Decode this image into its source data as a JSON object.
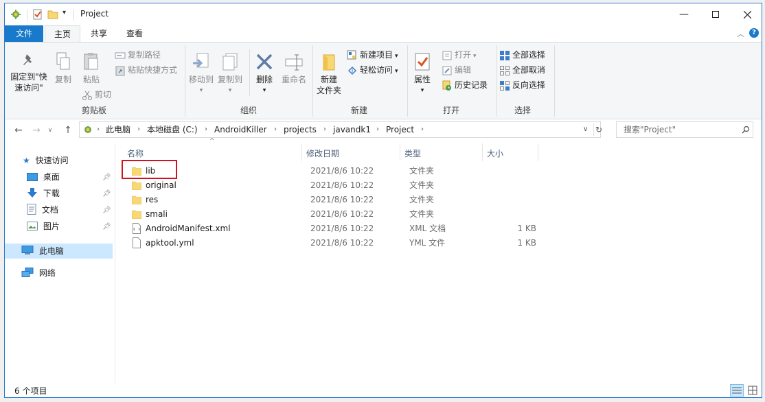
{
  "window": {
    "title": "Project"
  },
  "ribbon_tabs": [
    "文件",
    "主页",
    "共享",
    "查看"
  ],
  "clipboard": {
    "pin_label_1": "固定到\"快",
    "pin_label_2": "速访问\"",
    "copy": "复制",
    "paste": "粘贴",
    "copy_path": "复制路径",
    "paste_shortcut": "粘贴快捷方式",
    "cut": "剪切",
    "group": "剪贴板"
  },
  "organize": {
    "move_to": "移动到",
    "copy_to": "复制到",
    "delete": "删除",
    "rename": "重命名",
    "group": "组织"
  },
  "new_group": {
    "new_folder_1": "新建",
    "new_folder_2": "文件夹",
    "new_item": "新建项目",
    "easy_access": "轻松访问",
    "group": "新建"
  },
  "open_group": {
    "properties": "属性",
    "open": "打开",
    "edit": "编辑",
    "history": "历史记录",
    "group": "打开"
  },
  "select_group": {
    "select_all": "全部选择",
    "select_none": "全部取消",
    "invert": "反向选择",
    "group": "选择"
  },
  "breadcrumb": [
    "此电脑",
    "本地磁盘 (C:)",
    "AndroidKiller",
    "projects",
    "javandk1",
    "Project"
  ],
  "search": {
    "placeholder": "搜索\"Project\""
  },
  "nav": {
    "quick_access": "快速访问",
    "desktop": "桌面",
    "downloads": "下载",
    "documents": "文档",
    "pictures": "图片",
    "this_pc": "此电脑",
    "network": "网络"
  },
  "columns": {
    "name": "名称",
    "date": "修改日期",
    "type": "类型",
    "size": "大小"
  },
  "files": [
    {
      "name": "lib",
      "date": "2021/8/6 10:22",
      "type": "文件夹",
      "size": "",
      "kind": "folder"
    },
    {
      "name": "original",
      "date": "2021/8/6 10:22",
      "type": "文件夹",
      "size": "",
      "kind": "folder"
    },
    {
      "name": "res",
      "date": "2021/8/6 10:22",
      "type": "文件夹",
      "size": "",
      "kind": "folder"
    },
    {
      "name": "smali",
      "date": "2021/8/6 10:22",
      "type": "文件夹",
      "size": "",
      "kind": "folder"
    },
    {
      "name": "AndroidManifest.xml",
      "date": "2021/8/6 10:22",
      "type": "XML 文档",
      "size": "1 KB",
      "kind": "file"
    },
    {
      "name": "apktool.yml",
      "date": "2021/8/6 10:22",
      "type": "YML 文件",
      "size": "1 KB",
      "kind": "file"
    }
  ],
  "status": {
    "item_count": "6 个项目"
  },
  "colors": {
    "accent": "#1979ca",
    "selection": "#cce8ff",
    "folder": "#f8d775",
    "highlight_box": "#d0131d"
  }
}
